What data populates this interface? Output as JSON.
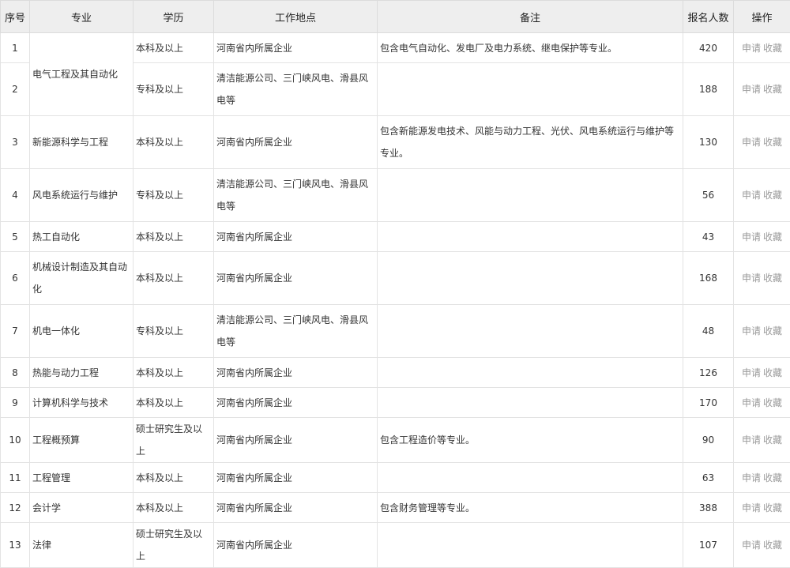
{
  "headers": {
    "index": "序号",
    "major": "专业",
    "education": "学历",
    "location": "工作地点",
    "remark": "备注",
    "applicants": "报名人数",
    "actions": "操作"
  },
  "actions": {
    "apply": "申请",
    "favorite": "收藏"
  },
  "rows": [
    {
      "index": "1",
      "major": "电气工程及其自动化",
      "education": "本科及以上",
      "location": "河南省内所属企业",
      "remark": "包含电气自动化、发电厂及电力系统、继电保护等专业。",
      "applicants": "420"
    },
    {
      "index": "2",
      "major": "",
      "education": "专科及以上",
      "location": "清洁能源公司、三门峡风电、滑县风电等",
      "remark": "",
      "applicants": "188"
    },
    {
      "index": "3",
      "major": "新能源科学与工程",
      "education": "本科及以上",
      "location": "河南省内所属企业",
      "remark": "包含新能源发电技术、风能与动力工程、光伏、风电系统运行与维护等专业。",
      "applicants": "130"
    },
    {
      "index": "4",
      "major": "风电系统运行与维护",
      "education": "专科及以上",
      "location": "清洁能源公司、三门峡风电、滑县风电等",
      "remark": "",
      "applicants": "56"
    },
    {
      "index": "5",
      "major": "热工自动化",
      "education": "本科及以上",
      "location": "河南省内所属企业",
      "remark": "",
      "applicants": "43"
    },
    {
      "index": "6",
      "major": "机械设计制造及其自动化",
      "education": "本科及以上",
      "location": "河南省内所属企业",
      "remark": "",
      "applicants": "168"
    },
    {
      "index": "7",
      "major": "机电一体化",
      "education": "专科及以上",
      "location": "清洁能源公司、三门峡风电、滑县风电等",
      "remark": "",
      "applicants": "48"
    },
    {
      "index": "8",
      "major": "热能与动力工程",
      "education": "本科及以上",
      "location": "河南省内所属企业",
      "remark": "",
      "applicants": "126"
    },
    {
      "index": "9",
      "major": "计算机科学与技术",
      "education": "本科及以上",
      "location": "河南省内所属企业",
      "remark": "",
      "applicants": "170"
    },
    {
      "index": "10",
      "major": "工程概预算",
      "education": "硕士研究生及以上",
      "location": "河南省内所属企业",
      "remark": "包含工程造价等专业。",
      "applicants": "90"
    },
    {
      "index": "11",
      "major": "工程管理",
      "education": "本科及以上",
      "location": "河南省内所属企业",
      "remark": "",
      "applicants": "63"
    },
    {
      "index": "12",
      "major": "会计学",
      "education": "本科及以上",
      "location": "河南省内所属企业",
      "remark": "包含财务管理等专业。",
      "applicants": "388"
    },
    {
      "index": "13",
      "major": "法律",
      "education": "硕士研究生及以上",
      "location": "河南省内所属企业",
      "remark": "",
      "applicants": "107"
    }
  ]
}
